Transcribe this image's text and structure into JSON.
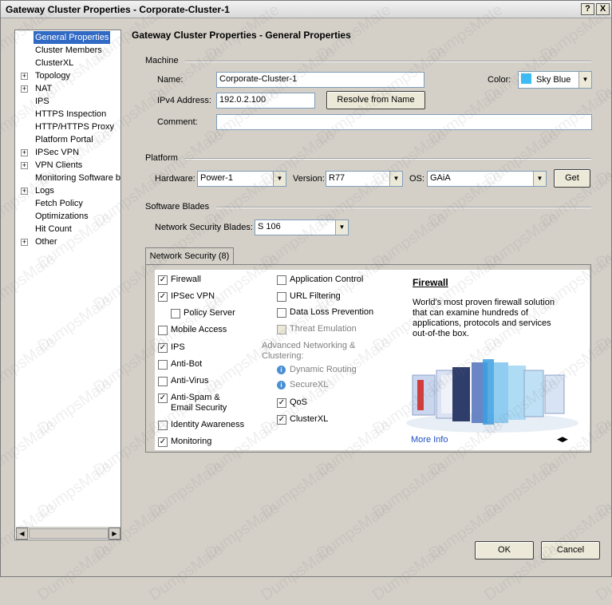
{
  "window": {
    "title": "Gateway Cluster Properties - Corporate-Cluster-1",
    "help_button": "?",
    "close_button": "X"
  },
  "tree": {
    "items": [
      {
        "label": "General Properties",
        "expandable": false,
        "selected": true
      },
      {
        "label": "Cluster Members",
        "expandable": false
      },
      {
        "label": "ClusterXL",
        "expandable": false
      },
      {
        "label": "Topology",
        "expandable": true
      },
      {
        "label": "NAT",
        "expandable": true
      },
      {
        "label": "IPS",
        "expandable": false
      },
      {
        "label": "HTTPS Inspection",
        "expandable": false
      },
      {
        "label": "HTTP/HTTPS Proxy",
        "expandable": false
      },
      {
        "label": "Platform Portal",
        "expandable": false
      },
      {
        "label": "IPSec VPN",
        "expandable": true
      },
      {
        "label": "VPN Clients",
        "expandable": true
      },
      {
        "label": "Monitoring Software bla",
        "expandable": false
      },
      {
        "label": "Logs",
        "expandable": true
      },
      {
        "label": "Fetch Policy",
        "expandable": false
      },
      {
        "label": "Optimizations",
        "expandable": false
      },
      {
        "label": "Hit Count",
        "expandable": false
      },
      {
        "label": "Other",
        "expandable": true
      }
    ]
  },
  "main": {
    "heading": "Gateway Cluster Properties - General Properties",
    "machine": {
      "section": "Machine",
      "name_label": "Name:",
      "name_value": "Corporate-Cluster-1",
      "color_label": "Color:",
      "color_value": "Sky Blue",
      "color_hex": "#3bbcf5",
      "ipv4_label": "IPv4 Address:",
      "ipv4_value": "192.0.2.100",
      "resolve_button": "Resolve from Name",
      "comment_label": "Comment:",
      "comment_value": ""
    },
    "platform": {
      "section": "Platform",
      "hardware_label": "Hardware:",
      "hardware_value": "Power-1",
      "version_label": "Version:",
      "version_value": "R77",
      "os_label": "OS:",
      "os_value": "GAiA",
      "get_button": "Get"
    },
    "blades": {
      "section": "Software Blades",
      "nsb_label": "Network Security Blades:",
      "nsb_value": "S   106"
    },
    "tab_label": "Network Security (8)",
    "col1": [
      {
        "label": "Firewall",
        "checked": true
      },
      {
        "label": "IPSec VPN",
        "checked": true
      },
      {
        "label": "Policy Server",
        "checked": false
      },
      {
        "label": "Mobile Access",
        "checked": false
      },
      {
        "label": "IPS",
        "checked": true
      },
      {
        "label": "Anti-Bot",
        "checked": false
      },
      {
        "label": "Anti-Virus",
        "checked": false
      },
      {
        "label": "Anti-Spam &",
        "label2": "Email Security",
        "checked": true
      },
      {
        "label": "Identity Awareness",
        "checked": false
      },
      {
        "label": "Monitoring",
        "checked": true
      }
    ],
    "col2": [
      {
        "label": "Application Control",
        "checked": false
      },
      {
        "label": "URL Filtering",
        "checked": false
      },
      {
        "label": "Data Loss Prevention",
        "checked": false
      },
      {
        "label": "Threat Emulation",
        "checked": false,
        "disabled": true
      }
    ],
    "adv_heading_1": "Advanced Networking &",
    "adv_heading_2": "Clustering:",
    "adv_info": [
      "Dynamic Routing",
      "SecureXL"
    ],
    "adv_checks": [
      {
        "label": "QoS",
        "checked": true
      },
      {
        "label": "ClusterXL",
        "checked": true
      }
    ],
    "description": {
      "title": "Firewall",
      "lines": [
        "World's most proven firewall solution",
        "that can examine hundreds of",
        "applications, protocols and services",
        "out-of-the box."
      ],
      "more_info": "More Info"
    }
  },
  "footer": {
    "ok_button": "OK",
    "cancel_button": "Cancel"
  },
  "watermark": "DumpsMate"
}
